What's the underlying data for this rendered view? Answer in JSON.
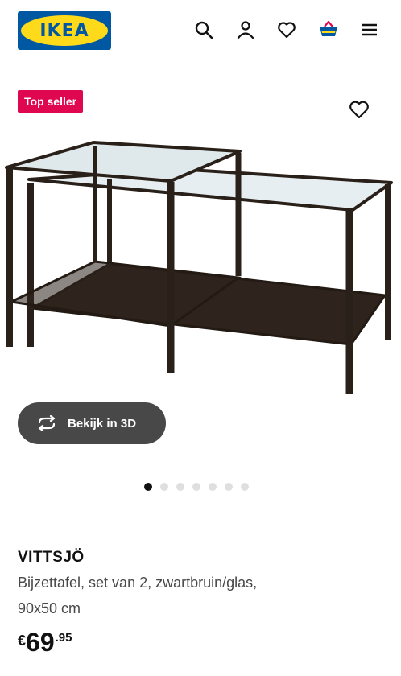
{
  "header": {
    "logo_text": "IKEA",
    "icons": [
      "search-icon",
      "account-icon",
      "wishlist-icon",
      "cart-icon",
      "menu-icon"
    ]
  },
  "badge": {
    "label": "Top seller"
  },
  "gallery": {
    "view3d_label": "Bekijk in 3D",
    "image_count": 7,
    "active_index": 0
  },
  "product": {
    "name": "VITTSJÖ",
    "description": "Bijzettafel, set van 2, zwartbruin/glas,",
    "dimensions": "90x50 cm",
    "price": {
      "currency": "€",
      "integer": "69",
      "decimal": ".95"
    }
  },
  "colors": {
    "ikea_blue": "#0058a3",
    "ikea_yellow": "#ffda1a",
    "badge_red": "#e00751",
    "button_dark": "#484848",
    "product_frame": "#2a201a"
  }
}
